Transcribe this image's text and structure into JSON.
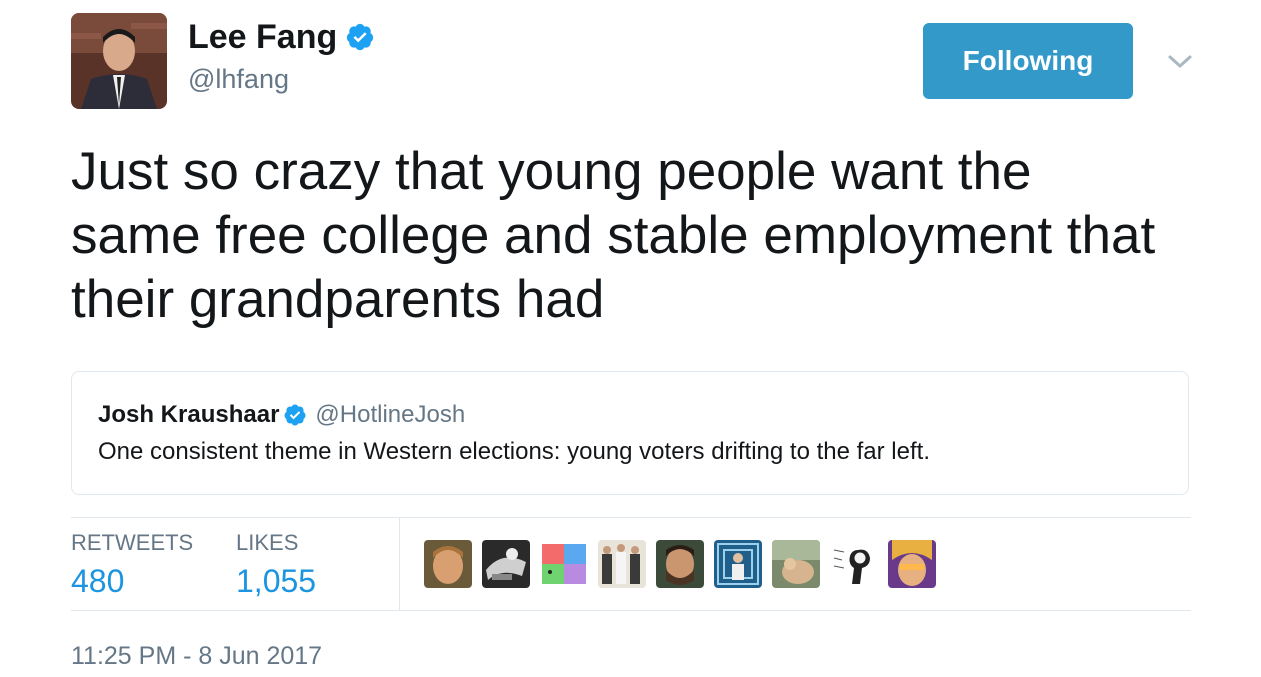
{
  "author": {
    "name": "Lee Fang",
    "handle": "@lhfang",
    "verified_icon": "verified-badge-icon",
    "avatar": "author-avatar"
  },
  "actions": {
    "follow_label": "Following",
    "menu_icon": "chevron-down-icon"
  },
  "tweet": {
    "text": "Just so crazy that young people want the same free college and stable employment that their grandparents had"
  },
  "quoted_tweet": {
    "name": "Josh Kraushaar",
    "handle": "@HotlineJosh",
    "text": "One consistent theme in Western elections: young voters drifting to the far left."
  },
  "stats": {
    "retweets_label": "RETWEETS",
    "retweets_value": "480",
    "likes_label": "LIKES",
    "likes_value": "1,055"
  },
  "timestamp": "11:25 PM - 8 Jun 2017",
  "colors": {
    "follow_button": "#3299c8",
    "stat_value": "#1b95e0",
    "muted_text": "#657786",
    "verified": "#1da1f2",
    "border": "#e1e8ed"
  }
}
